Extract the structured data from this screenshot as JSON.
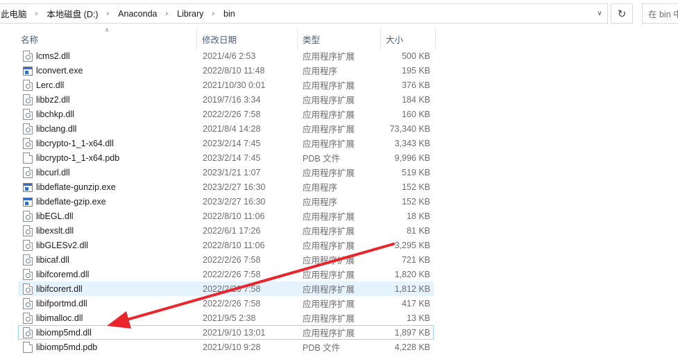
{
  "address_bar": {
    "crumbs": [
      "此电脑",
      "本地磁盘 (D:)",
      "Anaconda",
      "Library",
      "bin"
    ],
    "search_placeholder": "在 bin 中"
  },
  "columns": {
    "name": "名称",
    "date": "修改日期",
    "type": "类型",
    "size": "大小"
  },
  "files": [
    {
      "name": "lcms2.dll",
      "date": "2021/4/6 2:53",
      "type": "应用程序扩展",
      "size": "500 KB",
      "icon": "dll-file-icon"
    },
    {
      "name": "lconvert.exe",
      "date": "2022/8/10 11:48",
      "type": "应用程序",
      "size": "195 KB",
      "icon": "exe-file-icon"
    },
    {
      "name": "Lerc.dll",
      "date": "2021/10/30 0:01",
      "type": "应用程序扩展",
      "size": "376 KB",
      "icon": "dll-file-icon"
    },
    {
      "name": "libbz2.dll",
      "date": "2019/7/16 3:34",
      "type": "应用程序扩展",
      "size": "184 KB",
      "icon": "dll-file-icon"
    },
    {
      "name": "libchkp.dll",
      "date": "2022/2/26 7:58",
      "type": "应用程序扩展",
      "size": "160 KB",
      "icon": "dll-file-icon"
    },
    {
      "name": "libclang.dll",
      "date": "2021/8/4 14:28",
      "type": "应用程序扩展",
      "size": "73,340 KB",
      "icon": "dll-file-icon"
    },
    {
      "name": "libcrypto-1_1-x64.dll",
      "date": "2023/2/14 7:45",
      "type": "应用程序扩展",
      "size": "3,343 KB",
      "icon": "dll-file-icon"
    },
    {
      "name": "libcrypto-1_1-x64.pdb",
      "date": "2023/2/14 7:45",
      "type": "PDB 文件",
      "size": "9,996 KB",
      "icon": "pdb-file-icon"
    },
    {
      "name": "libcurl.dll",
      "date": "2023/1/21 1:07",
      "type": "应用程序扩展",
      "size": "519 KB",
      "icon": "dll-file-icon"
    },
    {
      "name": "libdeflate-gunzip.exe",
      "date": "2023/2/27 16:30",
      "type": "应用程序",
      "size": "152 KB",
      "icon": "exe-file-icon"
    },
    {
      "name": "libdeflate-gzip.exe",
      "date": "2023/2/27 16:30",
      "type": "应用程序",
      "size": "152 KB",
      "icon": "exe-file-icon"
    },
    {
      "name": "libEGL.dll",
      "date": "2022/8/10 11:06",
      "type": "应用程序扩展",
      "size": "18 KB",
      "icon": "dll-file-icon"
    },
    {
      "name": "libexslt.dll",
      "date": "2022/6/1 17:26",
      "type": "应用程序扩展",
      "size": "81 KB",
      "icon": "dll-file-icon"
    },
    {
      "name": "libGLESv2.dll",
      "date": "2022/8/10 11:06",
      "type": "应用程序扩展",
      "size": "3,295 KB",
      "icon": "dll-file-icon"
    },
    {
      "name": "libicaf.dll",
      "date": "2022/2/26 7:58",
      "type": "应用程序扩展",
      "size": "721 KB",
      "icon": "dll-file-icon"
    },
    {
      "name": "libifcoremd.dll",
      "date": "2022/2/26 7:58",
      "type": "应用程序扩展",
      "size": "1,820 KB",
      "icon": "dll-file-icon"
    },
    {
      "name": "libifcorert.dll",
      "date": "2022/2/26 7:58",
      "type": "应用程序扩展",
      "size": "1,812 KB",
      "icon": "dll-file-icon",
      "state": "hover"
    },
    {
      "name": "libifportmd.dll",
      "date": "2022/2/26 7:58",
      "type": "应用程序扩展",
      "size": "417 KB",
      "icon": "dll-file-icon"
    },
    {
      "name": "libimalloc.dll",
      "date": "2021/9/5 2:38",
      "type": "应用程序扩展",
      "size": "13 KB",
      "icon": "dll-file-icon"
    },
    {
      "name": "libiomp5md.dll",
      "date": "2021/9/10 13:01",
      "type": "应用程序扩展",
      "size": "1,897 KB",
      "icon": "dll-file-icon",
      "state": "selected"
    },
    {
      "name": "libiomp5md.pdb",
      "date": "2021/9/10 9:28",
      "type": "PDB 文件",
      "size": "4,228 KB",
      "icon": "pdb-file-icon"
    }
  ],
  "annotation_color": "#e8262b"
}
